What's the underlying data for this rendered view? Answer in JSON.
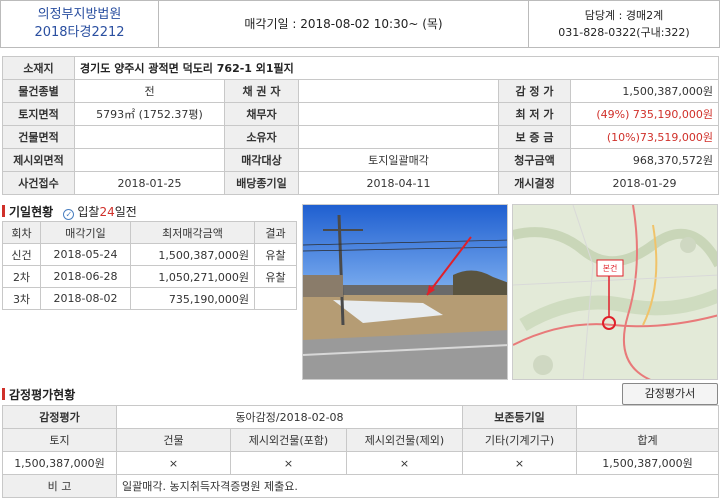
{
  "header": {
    "court": "의정부지방법원",
    "case_no": "2018타경2212",
    "auction_date": "매각기일 : 2018-08-02   10:30~ (목)",
    "contact_dept": "담당계 : 경매2계",
    "contact_phone": "031-828-0322(구내:322)"
  },
  "info": {
    "address_label": "소재지",
    "address": "경기도 양주시 광적면 덕도리 762-1 외1필지",
    "rows": [
      {
        "l1": "물건종별",
        "v1": "전",
        "l2": "채 권 자",
        "v2": "",
        "l3": "감 정 가",
        "v3": "1,500,387,000원"
      },
      {
        "l1": "토지면적",
        "v1": "5793㎡ (1752.37평)",
        "l2": "채무자",
        "v2": "",
        "l3": "최 저 가",
        "v3": "(49%) 735,190,000원"
      },
      {
        "l1": "건물면적",
        "v1": "",
        "l2": "소유자",
        "v2": "",
        "l3": "보 증 금",
        "v3": "(10%)73,519,000원"
      },
      {
        "l1": "제시외면적",
        "v1": "",
        "l2": "매각대상",
        "v2": "토지일괄매각",
        "l3": "청구금액",
        "v3": "968,370,572원"
      },
      {
        "l1": "사건접수",
        "v1": "2018-01-25",
        "l2": "배당종기일",
        "v2": "2018-04-11",
        "l3": "개시결정",
        "v3": "2018-01-29"
      }
    ]
  },
  "history": {
    "title": "기일현황",
    "badge_prefix": "입찰",
    "badge_days": "24",
    "badge_suffix": "일전",
    "headers": [
      "회차",
      "매각기일",
      "최저매각금액",
      "결과"
    ],
    "rows": [
      {
        "round": "신건",
        "date": "2018-05-24",
        "price": "1,500,387,000원",
        "result": "유찰"
      },
      {
        "round": "2차",
        "date": "2018-06-28",
        "price": "1,050,271,000원",
        "result": "유찰"
      },
      {
        "round": "3차",
        "date": "2018-08-02",
        "price": "735,190,000원",
        "result": ""
      }
    ]
  },
  "map": {
    "marker_label": "본건"
  },
  "appraisal": {
    "title": "감정평가현황",
    "button_label": "감정평가서",
    "row1": {
      "l1": "감정평가",
      "v1": "동아감정/2018-02-08",
      "l2": "보존등기일",
      "v2": ""
    },
    "col_headers": [
      "토지",
      "건물",
      "제시외건물(포함)",
      "제시외건물(제외)",
      "기타(기계기구)",
      "합계"
    ],
    "col_values": [
      "1,500,387,000원",
      "×",
      "×",
      "×",
      "×",
      "1,500,387,000원"
    ],
    "note_label": "비 고",
    "note": "일괄매각. 농지취득자격증명원 제출요."
  }
}
